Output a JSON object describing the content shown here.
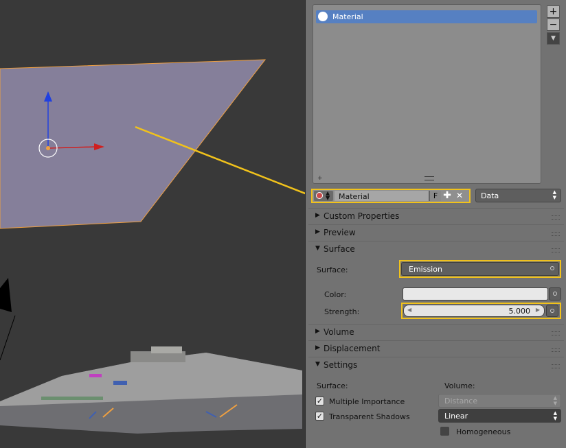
{
  "material_slot": {
    "name": "Material"
  },
  "material_selector": {
    "name": "Material",
    "fake_user": "F",
    "link_type": "Data"
  },
  "sections": {
    "custom_properties": "Custom Properties",
    "preview": "Preview",
    "surface": "Surface",
    "volume": "Volume",
    "displacement": "Displacement",
    "settings": "Settings"
  },
  "surface": {
    "surface_label": "Surface:",
    "surface_value": "Emission",
    "color_label": "Color:",
    "strength_label": "Strength:",
    "strength_value": "5.000"
  },
  "settings": {
    "surface_label": "Surface:",
    "volume_label": "Volume:",
    "multiple_importance": "Multiple Importance",
    "transparent_shadows": "Transparent Shadows",
    "volume_sampling": "Distance",
    "volume_interpolation": "Linear",
    "homogeneous": "Homogeneous"
  },
  "colors": {
    "highlight": "#f1c21b",
    "selection": "#5680c2",
    "plane": "#857f9a"
  },
  "checkboxes": {
    "multiple_importance": true,
    "transparent_shadows": true,
    "homogeneous": false
  }
}
